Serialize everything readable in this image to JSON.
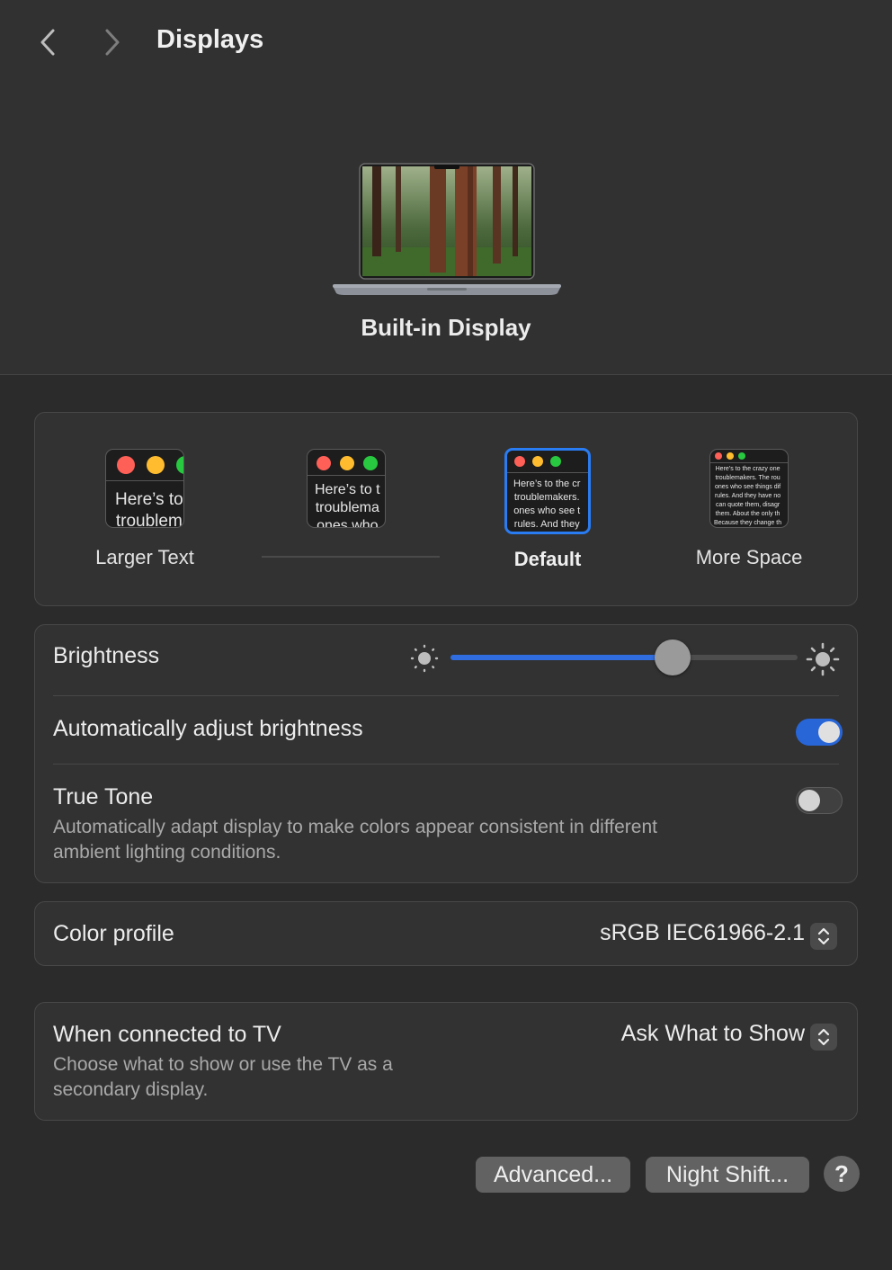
{
  "header": {
    "back_icon": "chevron-left-icon",
    "forward_icon": "chevron-right-icon",
    "title": "Displays"
  },
  "display": {
    "icon": "laptop-icon",
    "name": "Built-in Display"
  },
  "resolution": {
    "options": [
      {
        "label": "Larger Text",
        "preview": "Here’s to\ntroublem",
        "selected": false
      },
      {
        "label": "",
        "preview": "Here’s to t\ntroublema\nones who",
        "selected": false
      },
      {
        "label": "Default",
        "preview": "Here’s to the cr\ntroublemakers.\nones who see t\nrules. And they",
        "selected": true
      },
      {
        "label": "More Space",
        "preview": "Here’s to the crazy one\ntroublemakers. The rou\nones who see things dif\nrules. And they have no\ncan quote them, disagr\nthem. About the only th\nBecause they change th",
        "selected": false
      }
    ]
  },
  "brightness": {
    "label": "Brightness",
    "value": 0.64,
    "low_icon": "sun-dim-icon",
    "high_icon": "sun-bright-icon"
  },
  "auto_brightness": {
    "label": "Automatically adjust brightness",
    "on": true
  },
  "true_tone": {
    "label": "True Tone",
    "description_line1": "Automatically adapt display to make colors appear consistent in different",
    "description_line2": "ambient lighting conditions.",
    "on": false
  },
  "color_profile": {
    "label": "Color profile",
    "value": "sRGB IEC61966-2.1"
  },
  "tv": {
    "label": "When connected to TV",
    "description_line1": "Choose what to show or use the TV as a",
    "description_line2": "secondary display.",
    "value": "Ask What to Show"
  },
  "buttons": {
    "advanced": "Advanced...",
    "night_shift": "Night Shift...",
    "help": "?"
  },
  "colors": {
    "accent": "#2f6de0",
    "window_red": "#fe5f57",
    "window_yellow": "#febc2e",
    "window_green": "#28c840"
  }
}
